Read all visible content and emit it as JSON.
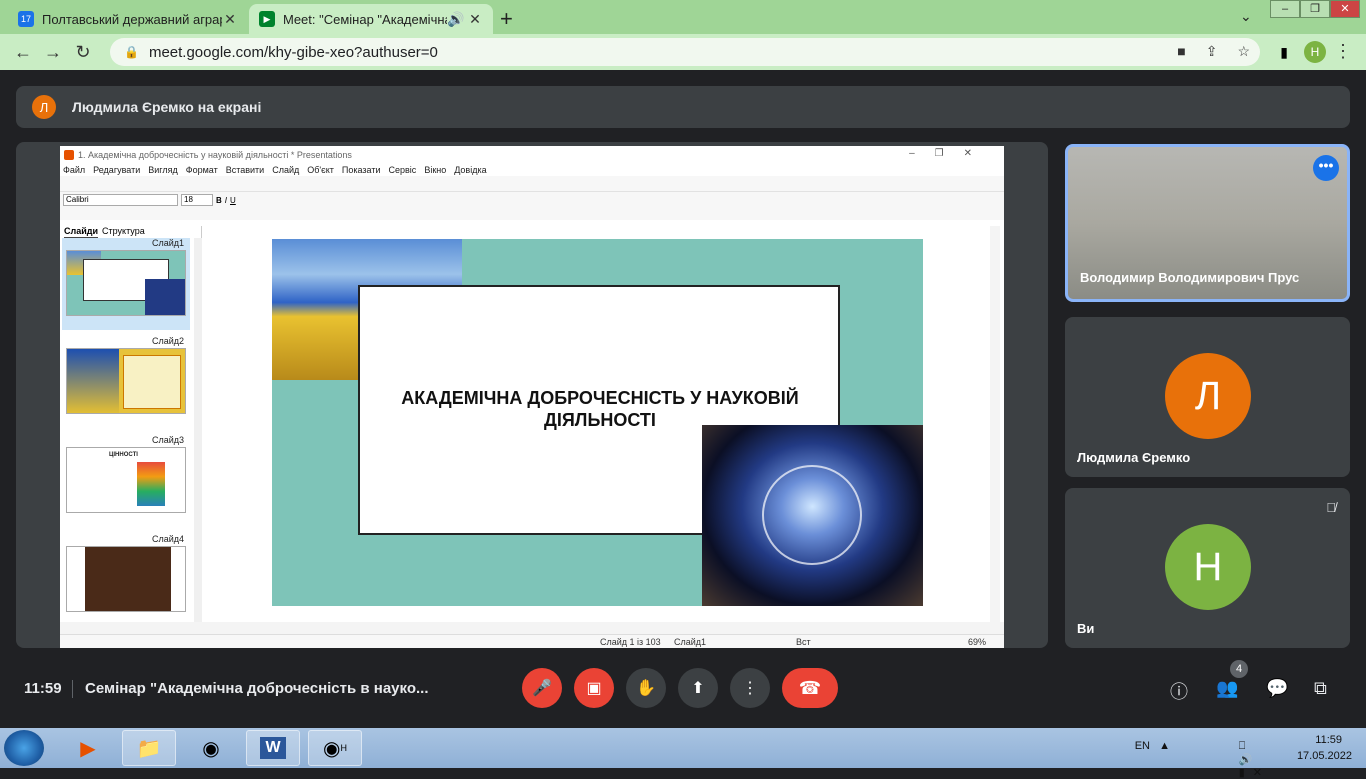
{
  "browser": {
    "tabs": [
      {
        "title": "Полтавський державний аграрн",
        "favicon": "calendar-17"
      },
      {
        "title": "Meet: \"Семінар \"Академічна",
        "favicon": "meet"
      }
    ],
    "url": "meet.google.com/khy-gibe-xeo?authuser=0",
    "profile_initial": "Н"
  },
  "meet": {
    "presenter_banner": "Людмила Єремко на екрані",
    "presenter_initial": "Л",
    "participants": [
      {
        "name": "Володимир Володимирович Прус",
        "has_video": true
      },
      {
        "name": "Людмила Єремко",
        "initial": "Л",
        "color": "#e8710a"
      },
      {
        "name": "Ви",
        "initial": "Н",
        "color": "#7cb342",
        "muted": true
      }
    ],
    "time": "11:59",
    "meeting_title": "Семінар \"Академічна доброчесність в науко...",
    "participants_count": "4"
  },
  "office": {
    "window_title": "1. Академічна доброчесність у науковій діяльності *   Presentations",
    "menu": [
      "Файл",
      "Редагувати",
      "Вигляд",
      "Формат",
      "Вставити",
      "Слайд",
      "Об'єкт",
      "Показати",
      "Сервіс",
      "Вікно",
      "Довідка"
    ],
    "font": "Calibri",
    "font_size": "18",
    "panel_tabs": [
      "Слайди",
      "Структура"
    ],
    "slides": [
      "Слайд1",
      "Слайд2",
      "Слайд3",
      "Слайд4"
    ],
    "thumb3_text": "ЦІННОСТІ",
    "slide_title": "АКАДЕМІЧНА ДОБРОЧЕСНІСТЬ У НАУКОВІЙ ДІЯЛЬНОСТІ",
    "status_slide": "Слайд 1 із 103",
    "status_layout": "Слайд1",
    "status_ins": "Вст",
    "zoom": "69%"
  },
  "taskbar": {
    "lang": "EN",
    "time": "11:59",
    "date": "17.05.2022",
    "word_letter": "W",
    "chrome_badge": "Н"
  },
  "colors": {
    "tab_strip": "#9fd596",
    "meet_bg": "#202124",
    "tile": "#3c4043",
    "red": "#ea4335"
  }
}
